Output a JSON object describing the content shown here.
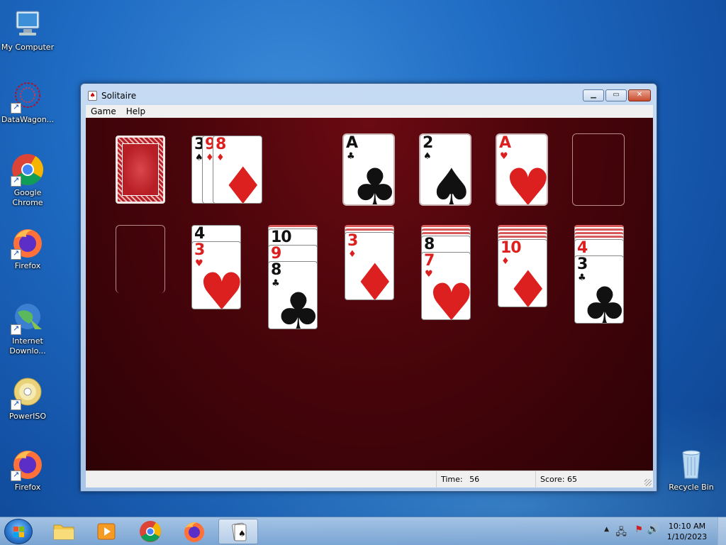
{
  "desktop": {
    "icons": [
      {
        "label": "My Computer"
      },
      {
        "label": "DataWagon..."
      },
      {
        "label": "Google Chrome"
      },
      {
        "label": "Firefox"
      },
      {
        "label": "Internet Downlo..."
      },
      {
        "label": "PowerISO"
      },
      {
        "label": "Firefox"
      },
      {
        "label": "Recycle Bin"
      }
    ]
  },
  "window": {
    "title": "Solitaire",
    "menu": [
      "Game",
      "Help"
    ],
    "status": {
      "time_label": "Time:",
      "time_value": "56",
      "score_text": "Score: 65"
    }
  },
  "game": {
    "waste": [
      {
        "rank": "3",
        "suit": "♠"
      },
      {
        "rank": "9",
        "suit": "♦"
      },
      {
        "rank": "8",
        "suit": "♦"
      }
    ],
    "foundations": [
      {
        "rank": "A",
        "suit": "♣"
      },
      {
        "rank": "2",
        "suit": "♠"
      },
      {
        "rank": "A",
        "suit": "♥"
      },
      {
        "rank": "",
        "suit": ""
      }
    ],
    "tableau": [
      {
        "cards": []
      },
      {
        "cards": [
          {
            "rank": "4",
            "suit": "♠"
          },
          {
            "rank": "3",
            "suit": "♥"
          }
        ]
      },
      {
        "cards": [
          {
            "rank": "10",
            "suit": "♣"
          },
          {
            "rank": "9",
            "suit": "♥"
          },
          {
            "rank": "8",
            "suit": "♣"
          }
        ]
      },
      {
        "cards": [
          {
            "rank": "3",
            "suit": "♦"
          }
        ]
      },
      {
        "cards": [
          {
            "rank": "8",
            "suit": "♠"
          },
          {
            "rank": "7",
            "suit": "♥"
          }
        ]
      },
      {
        "cards": [
          {
            "rank": "10",
            "suit": "♦"
          }
        ]
      },
      {
        "cards": [
          {
            "rank": "4",
            "suit": "♥"
          },
          {
            "rank": "3",
            "suit": "♣"
          }
        ]
      }
    ]
  },
  "taskbar": {
    "clock_time": "10:10 AM",
    "clock_date": "1/10/2023"
  }
}
